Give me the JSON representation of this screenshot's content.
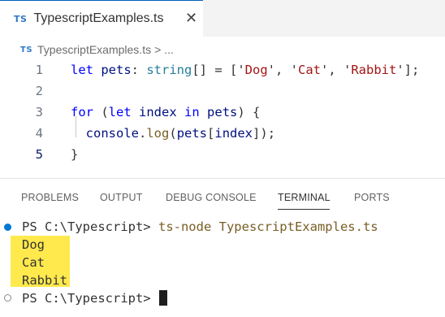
{
  "tab": {
    "icon": "TS",
    "title": "TypescriptExamples.ts",
    "close": "✕"
  },
  "breadcrumb": {
    "icon": "TS",
    "file": "TypescriptExamples.ts",
    "separator": ">",
    "more": "..."
  },
  "editor": {
    "lines": [
      {
        "num": "1",
        "tokens": [
          [
            "kw",
            "let"
          ],
          [
            "punc",
            " "
          ],
          [
            "var",
            "pets"
          ],
          [
            "punc",
            ": "
          ],
          [
            "type",
            "string"
          ],
          [
            "punc",
            "[] = ['"
          ],
          [
            "str",
            "Dog"
          ],
          [
            "punc",
            "', '"
          ],
          [
            "str",
            "Cat"
          ],
          [
            "punc",
            "', '"
          ],
          [
            "str",
            "Rabbit"
          ],
          [
            "punc",
            "'];"
          ]
        ]
      },
      {
        "num": "2",
        "tokens": []
      },
      {
        "num": "3",
        "tokens": [
          [
            "kw",
            "for"
          ],
          [
            "punc",
            " ("
          ],
          [
            "kw",
            "let"
          ],
          [
            "punc",
            " "
          ],
          [
            "var",
            "index"
          ],
          [
            "punc",
            " "
          ],
          [
            "kw",
            "in"
          ],
          [
            "punc",
            " "
          ],
          [
            "var",
            "pets"
          ],
          [
            "punc",
            ") {"
          ]
        ]
      },
      {
        "num": "4",
        "tokens": [
          [
            "punc",
            "  "
          ],
          [
            "var",
            "console"
          ],
          [
            "punc",
            "."
          ],
          [
            "fn",
            "log"
          ],
          [
            "punc",
            "("
          ],
          [
            "var",
            "pets"
          ],
          [
            "punc",
            "["
          ],
          [
            "var",
            "index"
          ],
          [
            "punc",
            "]);"
          ]
        ]
      },
      {
        "num": "5",
        "tokens": [
          [
            "punc",
            "}"
          ]
        ]
      }
    ],
    "active_line": "5"
  },
  "panel": {
    "tabs": [
      "PROBLEMS",
      "OUTPUT",
      "DEBUG CONSOLE",
      "TERMINAL",
      "PORTS"
    ],
    "active_tab": "TERMINAL"
  },
  "terminal": {
    "prompt1": "PS C:\\Typescript> ",
    "command": "ts-node TypescriptExamples.ts",
    "output": [
      "Dog",
      "Cat",
      "Rabbit"
    ],
    "prompt2": "PS C:\\Typescript> "
  },
  "colors": {
    "ts_blue": "#3178c6",
    "accent": "#005fb8",
    "highlight": "#ffe94d",
    "terminal_success_dot": "#0078d4"
  }
}
